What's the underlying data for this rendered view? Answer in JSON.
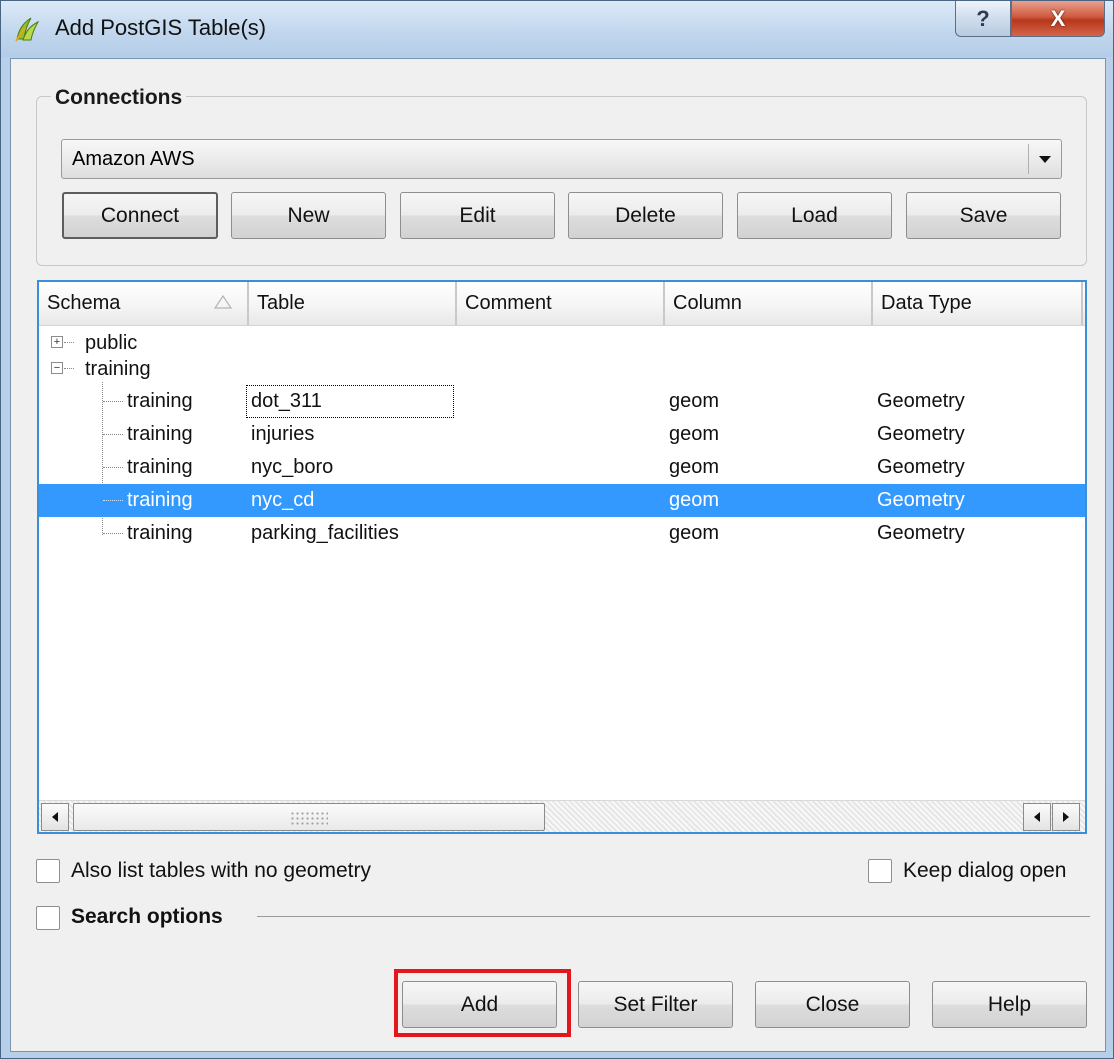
{
  "window": {
    "title": "Add PostGIS Table(s)",
    "help_glyph": "?",
    "close_glyph": "X"
  },
  "connections": {
    "group_title": "Connections",
    "selected": "Amazon AWS",
    "buttons": {
      "connect": "Connect",
      "new": "New",
      "edit": "Edit",
      "delete": "Delete",
      "load": "Load",
      "save": "Save"
    }
  },
  "table": {
    "columns": [
      "Schema",
      "Table",
      "Comment",
      "Column",
      "Data Type"
    ],
    "schemas": [
      {
        "name": "public",
        "expanded": false
      },
      {
        "name": "training",
        "expanded": true
      }
    ],
    "rows": [
      {
        "schema": "training",
        "table": "dot_311",
        "comment": "",
        "column": "geom",
        "data_type": "Geometry",
        "selected": false,
        "focused": true
      },
      {
        "schema": "training",
        "table": "injuries",
        "comment": "",
        "column": "geom",
        "data_type": "Geometry",
        "selected": false,
        "focused": false
      },
      {
        "schema": "training",
        "table": "nyc_boro",
        "comment": "",
        "column": "geom",
        "data_type": "Geometry",
        "selected": false,
        "focused": false
      },
      {
        "schema": "training",
        "table": "nyc_cd",
        "comment": "",
        "column": "geom",
        "data_type": "Geometry",
        "selected": true,
        "focused": false
      },
      {
        "schema": "training",
        "table": "parking_facilities",
        "comment": "",
        "column": "geom",
        "data_type": "Geometry",
        "selected": false,
        "focused": false
      }
    ],
    "selection_color": "#3399ff"
  },
  "options": {
    "no_geometry_label": "Also list tables with no geometry",
    "no_geometry_checked": false,
    "keep_open_label": "Keep dialog open",
    "keep_open_checked": false,
    "search_options_label": "Search options",
    "search_options_checked": false
  },
  "footer": {
    "add": "Add",
    "set_filter": "Set Filter",
    "close": "Close",
    "help": "Help"
  },
  "annotation": {
    "highlight_color": "#e3161b",
    "highlighted_button": "add-button"
  }
}
